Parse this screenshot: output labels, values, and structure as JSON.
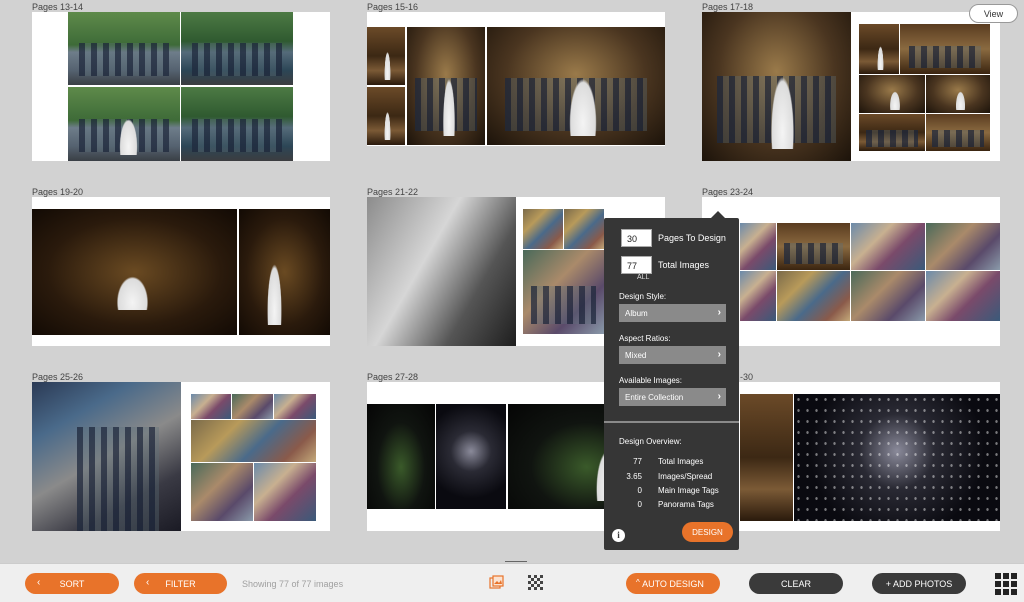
{
  "spreads": [
    {
      "label": "Pages 13-14"
    },
    {
      "label": "Pages 15-16"
    },
    {
      "label": "Pages 17-18"
    },
    {
      "label": "Pages 19-20"
    },
    {
      "label": "Pages 21-22"
    },
    {
      "label": "Pages 23-24"
    },
    {
      "label": "Pages 25-26"
    },
    {
      "label": "Pages 27-28"
    },
    {
      "label": "-30"
    }
  ],
  "view_button": "View",
  "panel": {
    "pages_to_design_value": "30",
    "pages_to_design_label": "Pages To Design",
    "total_images_value": "77",
    "total_images_label": "Total Images",
    "all_label": "ALL",
    "design_style_label": "Design Style:",
    "design_style_value": "Album",
    "aspect_ratios_label": "Aspect Ratios:",
    "aspect_ratios_value": "Mixed",
    "available_images_label": "Available Images:",
    "available_images_value": "Entire Collection",
    "overview_title": "Design Overview:",
    "overview": [
      {
        "value": "77",
        "label": "Total Images"
      },
      {
        "value": "3.65",
        "label": "Images/Spread"
      },
      {
        "value": "0",
        "label": "Main Image Tags"
      },
      {
        "value": "0",
        "label": "Panorama Tags"
      }
    ],
    "design_button": "DESIGN",
    "info_icon": "i"
  },
  "toolbar": {
    "sort_label": "SORT",
    "filter_label": "FILTER",
    "status_text": "Showing 77 of 77 images",
    "auto_design_label": "AUTO DESIGN",
    "clear_label": "CLEAR",
    "add_photos_label": "+ ADD PHOTOS"
  },
  "colors": {
    "accent": "#e8732a",
    "panel_bg": "#363636",
    "dark_button": "#3a3a3a"
  }
}
